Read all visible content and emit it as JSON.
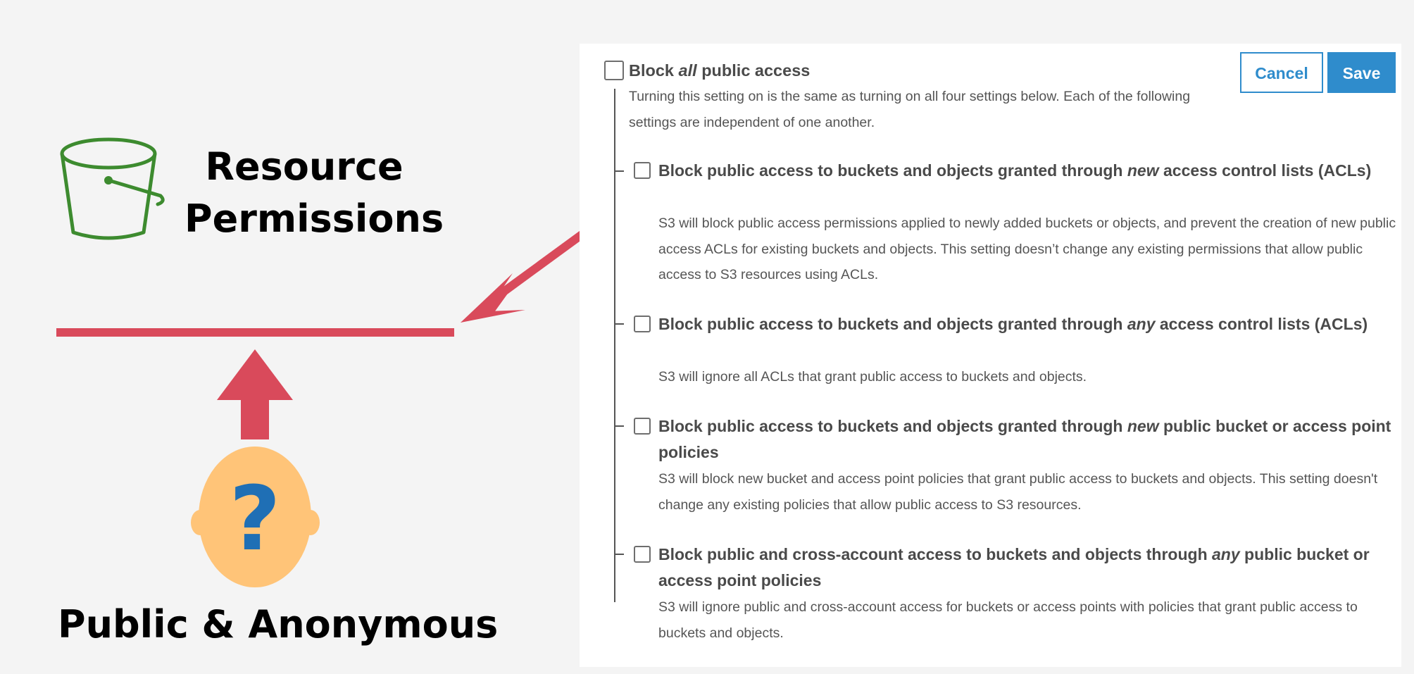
{
  "illustration": {
    "resource_title_line1": "Resource",
    "resource_title_line2": "Permissions",
    "public_label": "Public & Anonymous",
    "bucket_icon": "bucket-icon",
    "person_icon": "anonymous-person-icon",
    "question_mark": "?",
    "colors": {
      "bucket_green": "#3d8b2f",
      "arrow_red": "#d94a5b",
      "face_orange": "#ffc478",
      "question_blue": "#1f6fb5"
    }
  },
  "panel": {
    "master": {
      "title_prefix": "Block ",
      "title_emphasis": "all",
      "title_suffix": " public access",
      "description": "Turning this setting on is the same as turning on all four settings below. Each of the following settings are independent of one another.",
      "checked": false
    },
    "buttons": {
      "cancel_label": "Cancel",
      "save_label": "Save"
    },
    "settings": [
      {
        "title_prefix": "Block public access to buckets and objects granted through ",
        "title_emphasis": "new",
        "title_suffix": " access control lists (ACLs)",
        "description": "S3 will block public access permissions applied to newly added buckets or objects, and prevent the creation of new public access ACLs for existing buckets and objects. This setting doesn’t change any existing permissions that allow public access to S3 resources using ACLs.",
        "checked": false
      },
      {
        "title_prefix": "Block public access to buckets and objects granted through ",
        "title_emphasis": "any",
        "title_suffix": " access control lists (ACLs)",
        "description": "S3 will ignore all ACLs that grant public access to buckets and objects.",
        "checked": false
      },
      {
        "title_prefix": "Block public access to buckets and objects granted through ",
        "title_emphasis": "new",
        "title_suffix": " public bucket or access point policies",
        "description": "S3 will block new bucket and access point policies that grant public access to buckets and objects. This setting doesn't change any existing policies that allow public access to S3 resources.",
        "checked": false
      },
      {
        "title_prefix": "Block public and cross-account access to buckets and objects through ",
        "title_emphasis": "any",
        "title_suffix": " public bucket or access point policies",
        "description": "S3 will ignore public and cross-account access for buckets or access points with policies that grant public access to buckets and objects.",
        "checked": false
      }
    ],
    "colors": {
      "accent": "#2f8ccc",
      "title_text": "#4a4a4a",
      "body_text": "#555555"
    }
  }
}
